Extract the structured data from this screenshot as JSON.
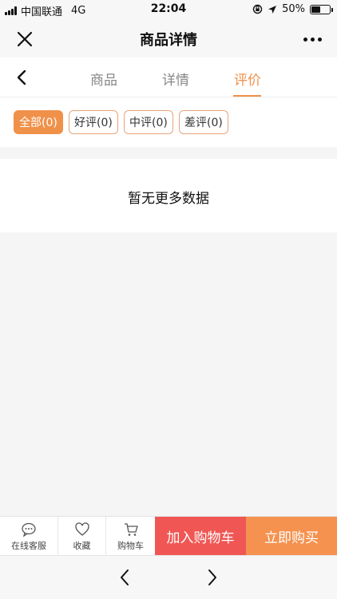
{
  "status_bar": {
    "carrier": "中国联通",
    "network": "4G",
    "time": "22:04",
    "battery": "50%",
    "battery_level": 0.5
  },
  "title_bar": {
    "title": "商品详情",
    "close_icon": "close-icon",
    "more_icon": "more-icon"
  },
  "tabs": {
    "back_icon": "chevron-left-icon",
    "items": [
      {
        "label": "商品"
      },
      {
        "label": "详情"
      },
      {
        "label": "评价",
        "active": true
      }
    ]
  },
  "filters": {
    "items": [
      {
        "label": "全部(0)",
        "active": true
      },
      {
        "label": "好评(0)"
      },
      {
        "label": "中评(0)"
      },
      {
        "label": "差评(0)"
      }
    ]
  },
  "empty_state": {
    "message": "暂无更多数据"
  },
  "action_bar": {
    "service_label": "在线客服",
    "favorite_label": "收藏",
    "cart_label": "购物车",
    "add_to_cart_label": "加入购物车",
    "buy_now_label": "立即购买",
    "colors": {
      "add_to_cart": "#f05754",
      "buy_now": "#f5924f",
      "accent": "#f0914a"
    }
  },
  "browser_nav": {
    "back_icon": "chevron-left-icon",
    "forward_icon": "chevron-right-icon"
  }
}
